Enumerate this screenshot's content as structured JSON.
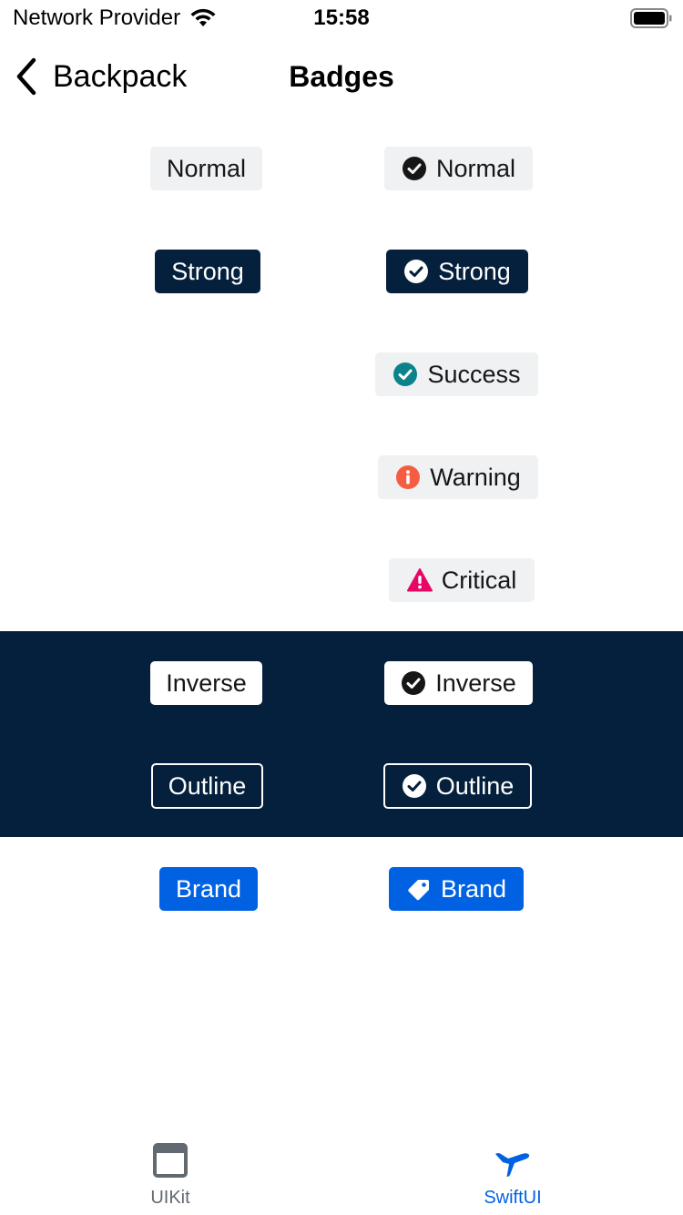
{
  "status_bar": {
    "carrier": "Network Provider",
    "time": "15:58"
  },
  "nav": {
    "back_label": "Backpack",
    "title": "Badges"
  },
  "badges": {
    "normal_plain": "Normal",
    "normal_icon": "Normal",
    "strong_plain": "Strong",
    "strong_icon": "Strong",
    "success": "Success",
    "warning": "Warning",
    "critical": "Critical",
    "inverse_plain": "Inverse",
    "inverse_icon": "Inverse",
    "outline_plain": "Outline",
    "outline_icon": "Outline",
    "brand_plain": "Brand",
    "brand_icon": "Brand"
  },
  "tabs": [
    {
      "label": "UIKit",
      "icon": "window-icon",
      "selected": false,
      "color": "#626971"
    },
    {
      "label": "SwiftUI",
      "icon": "plane-icon",
      "selected": true,
      "color": "#0062e3"
    }
  ],
  "colors": {
    "dark_band": "#05203c",
    "badge_normal_bg": "#eff1f2",
    "badge_strong_bg": "#05203c",
    "brand": "#0062e3",
    "success_icon": "#0c838a",
    "warning_icon": "#f55d42",
    "critical_icon": "#e70866"
  }
}
